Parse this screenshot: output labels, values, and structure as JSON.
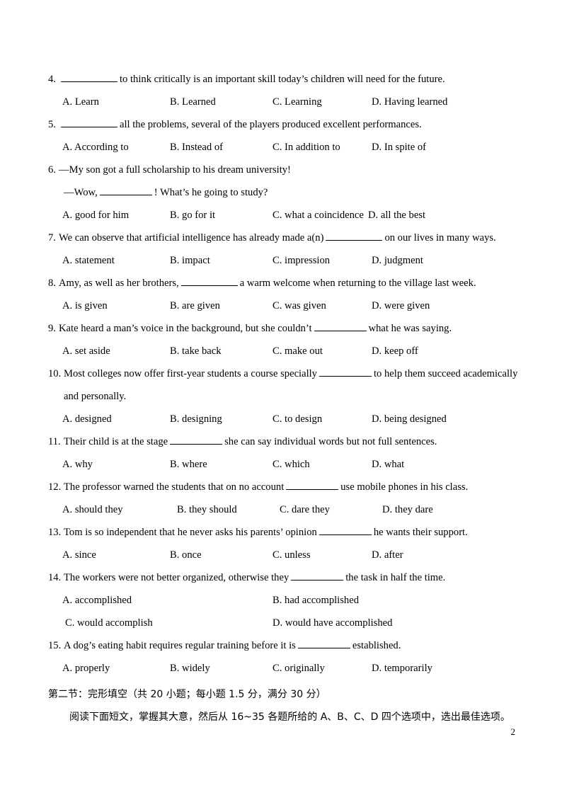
{
  "document": {
    "page_number": "2"
  },
  "questions": [
    {
      "number": "4.",
      "stem_pre": "",
      "stem_post": "to think critically is an important skill today’s children will need for the future.",
      "options": [
        "A. Learn",
        "B. Learned",
        "C. Learning",
        "D. Having learned"
      ]
    },
    {
      "number": "5.",
      "stem_pre": "",
      "stem_post": "all the problems, several of the players produced excellent performances.",
      "options": [
        "A. According to",
        "B. Instead of",
        "C. In addition to",
        "D. In spite of"
      ]
    },
    {
      "number": "6.",
      "line1": "—My son got a full scholarship to his dream university!",
      "line2_pre": "—Wow,",
      "line2_post": "! What’s he going to study?",
      "options": [
        "A. good for him",
        "B. go for it",
        "C. what a coincidence",
        "D. all the best"
      ]
    },
    {
      "number": "7.",
      "stem_pre": "We can observe that artificial intelligence has already made a(n)",
      "stem_post": "on our lives in many ways.",
      "options": [
        "A. statement",
        "B. impact",
        "C. impression",
        "D. judgment"
      ]
    },
    {
      "number": "8.",
      "stem_pre": "Amy, as well as her brothers,",
      "stem_post": "a warm welcome when returning to the village last week.",
      "options": [
        "A. is given",
        "B. are given",
        "C. was given",
        "D. were given"
      ]
    },
    {
      "number": "9.",
      "stem_pre": "Kate heard a man’s voice in the background, but she couldn’t",
      "stem_post": "what he was saying.",
      "options": [
        "A. set aside",
        "B. take back",
        "C. make out",
        "D. keep off"
      ]
    },
    {
      "number": "10.",
      "stem_pre": "Most colleges now offer first-year students a course specially",
      "stem_post": "to help them succeed academically",
      "continuation": "and personally.",
      "options": [
        "A. designed",
        "B. designing",
        "C. to design",
        "D. being designed"
      ]
    },
    {
      "number": "11.",
      "stem_pre": "Their child is at the stage",
      "stem_post": "she can say individual words but not full sentences.",
      "options": [
        "A. why",
        "B. where",
        "C. which",
        "D. what"
      ]
    },
    {
      "number": "12.",
      "stem_pre": "The professor warned the students that on no account",
      "stem_post": "use mobile phones in his class.",
      "options": [
        "A. should they",
        "B. they should",
        "C. dare they",
        "D. they dare"
      ]
    },
    {
      "number": "13.",
      "stem_pre": "Tom is so independent that he never asks his parents’ opinion",
      "stem_post": "he wants their support.",
      "options": [
        "A. since",
        "B. once",
        "C. unless",
        "D. after"
      ]
    },
    {
      "number": "14.",
      "stem_pre": "The workers were not better organized, otherwise they",
      "stem_post": "the task in half the time.",
      "options": [
        "A. accomplished",
        "B. had accomplished",
        "C. would accomplish",
        "D. would have accomplished"
      ]
    },
    {
      "number": "15.",
      "stem_pre": "A dog’s eating habit requires regular training before it is",
      "stem_post": "established.",
      "options": [
        "A. properly",
        "B. widely",
        "C. originally",
        "D. temporarily"
      ]
    }
  ],
  "section": {
    "heading": "第二节：完形填空（共 20 小题；每小题 1.5 分，满分 30 分）",
    "instruction": "阅读下面短文，掌握其大意，然后从 16~35 各题所给的 A、B、C、D 四个选项中，选出最佳选项。"
  }
}
